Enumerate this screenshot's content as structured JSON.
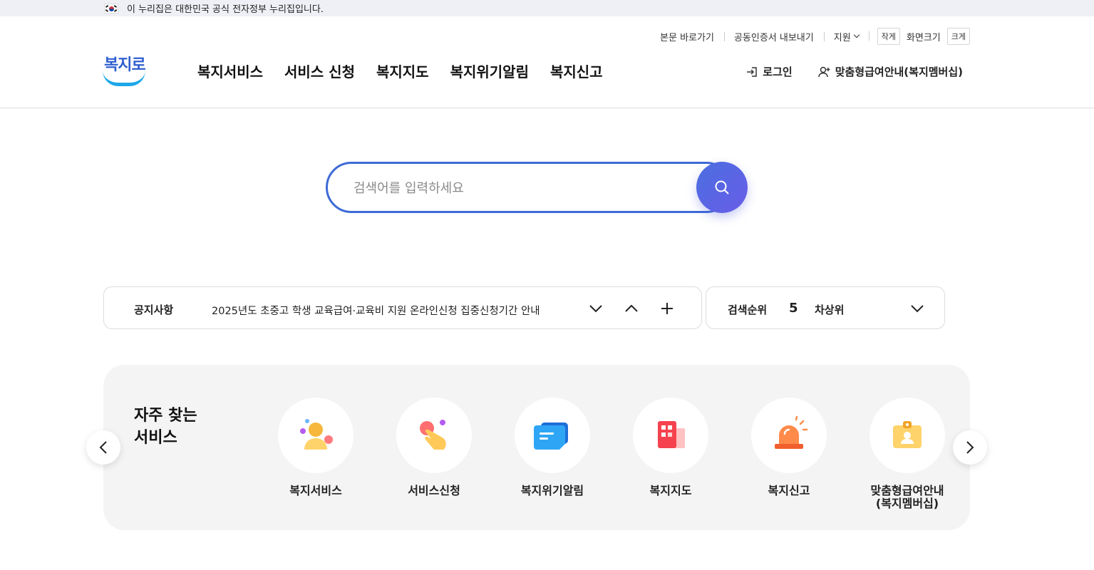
{
  "gov_banner": {
    "text": "이 누리집은 대한민국 공식 전자정부 누리집입니다."
  },
  "util": {
    "skip_link": "본문 바로가기",
    "cert_export": "공동인증서 내보내기",
    "support": "지원",
    "font_small": "작게",
    "font_label": "화면크기",
    "font_large": "크게"
  },
  "logo": {
    "text": "복지로"
  },
  "gnb": [
    "복지서비스",
    "서비스 신청",
    "복지지도",
    "복지위기알림",
    "복지신고"
  ],
  "user_menu": {
    "login": "로그인",
    "membership": "맞춤형급여안내(복지멤버십)"
  },
  "search": {
    "placeholder": "검색어를 입력하세요"
  },
  "notice": {
    "label": "공지사항",
    "text": "2025년도 초중고 학생 교육급여·교육비 지원 온라인신청 집중신청기간 안내"
  },
  "ranking": {
    "label": "검색순위",
    "number": "5",
    "keyword": "차상위"
  },
  "frequent": {
    "title": "자주 찾는\n서비스",
    "items": [
      {
        "label": "복지서비스",
        "icon": "person-service-icon"
      },
      {
        "label": "서비스신청",
        "icon": "hand-touch-icon"
      },
      {
        "label": "복지위기알림",
        "icon": "chat-alert-icon"
      },
      {
        "label": "복지지도",
        "icon": "building-map-icon"
      },
      {
        "label": "복지신고",
        "icon": "siren-icon"
      },
      {
        "label": "맞춤형급여안내\n(복지멤버십)",
        "icon": "id-card-icon"
      }
    ]
  },
  "colors": {
    "brand": "#3d6ad6",
    "accent_purple": "#6a5de8",
    "logo_blue": "#1ea7e8"
  }
}
